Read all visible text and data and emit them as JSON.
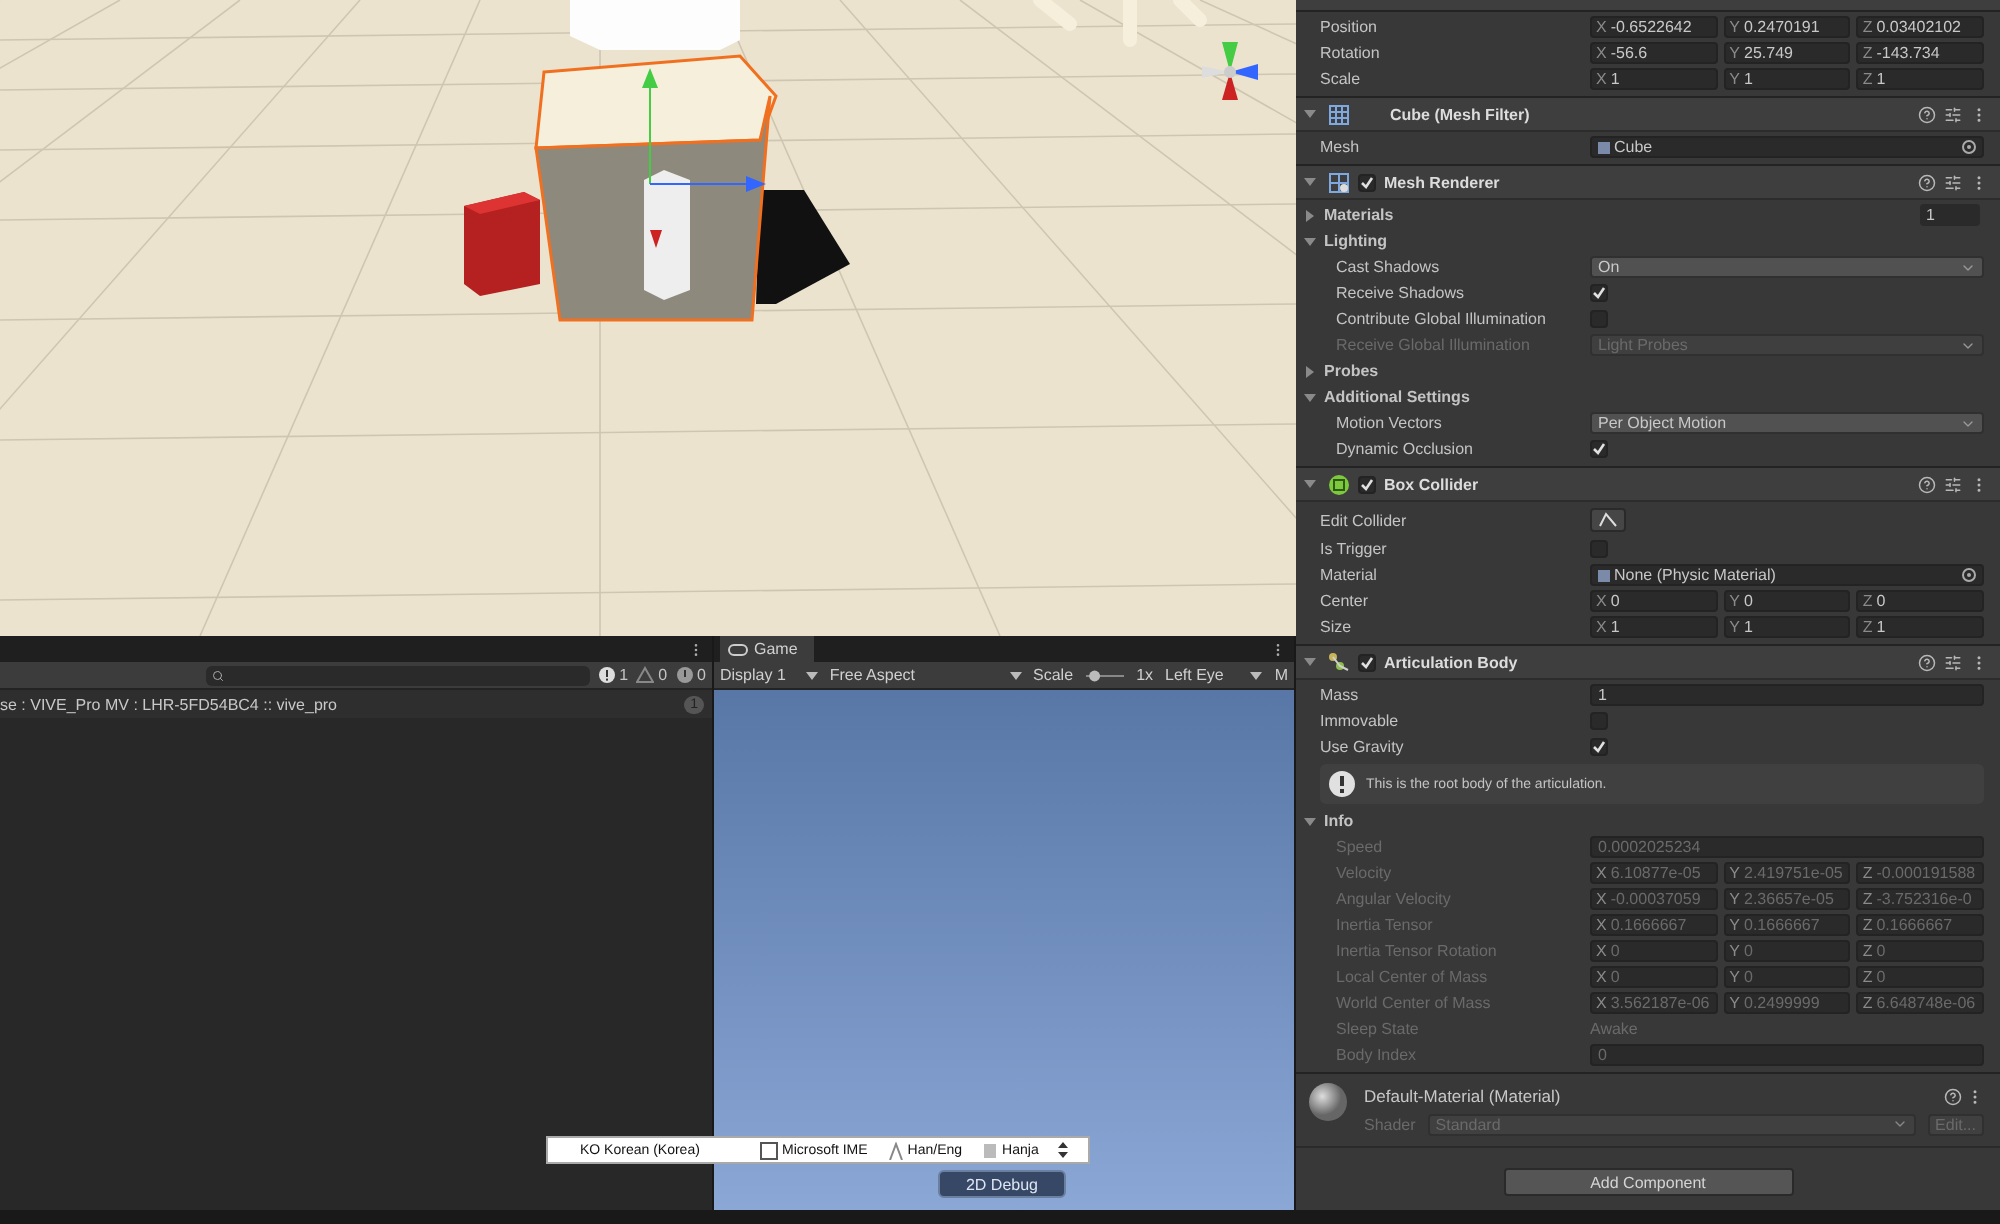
{
  "console": {
    "counters": [
      {
        "kind": "message",
        "count": "1"
      },
      {
        "kind": "warning",
        "count": "0"
      },
      {
        "kind": "info",
        "count": "0"
      }
    ],
    "logs": [
      {
        "text": "se : VIVE_Pro MV : LHR-5FD54BC4 :: vive_pro",
        "count": "1"
      }
    ]
  },
  "game": {
    "tab": "Game",
    "display": "Display 1",
    "aspect": "Free Aspect",
    "scale_label": "Scale",
    "scale_slider": {
      "level": 0.1
    },
    "scale": "1x",
    "eye": "Left Eye",
    "more": "M",
    "debug_button": "2D Debug"
  },
  "ime_bar": {
    "language": "KO Korean (Korea)",
    "ime": "Microsoft IME",
    "mode": "Han/Eng",
    "hanja": "Hanja"
  },
  "inspector": {
    "components": [
      {
        "kind": "transform",
        "rows": [
          {
            "kind": "vector3",
            "label": "Position",
            "fields": [
              {
                "axis": "X",
                "value": "-0.6522642"
              },
              {
                "axis": "Y",
                "value": "0.2470191"
              },
              {
                "axis": "Z",
                "value": "0.03402102"
              }
            ],
            "disabled": false
          },
          {
            "kind": "vector3",
            "label": "Rotation",
            "fields": [
              {
                "axis": "X",
                "value": "-56.6"
              },
              {
                "axis": "Y",
                "value": "25.749"
              },
              {
                "axis": "Z",
                "value": "-143.734"
              }
            ],
            "disabled": false
          },
          {
            "kind": "vector3",
            "label": "Scale",
            "fields": [
              {
                "axis": "X",
                "value": "1"
              },
              {
                "axis": "Y",
                "value": "1"
              },
              {
                "axis": "Z",
                "value": "1"
              }
            ],
            "disabled": false
          }
        ]
      },
      {
        "kind": "mesh_filter",
        "title": "Cube (Mesh Filter)",
        "rows": [
          {
            "kind": "object",
            "label": "Mesh",
            "value": "Cube",
            "disabled": false
          }
        ]
      },
      {
        "kind": "mesh_renderer",
        "title": "Mesh Renderer",
        "enabled": true,
        "rows": [
          {
            "kind": "foldout",
            "label": "Materials",
            "value": "1",
            "expanded": false,
            "children": []
          },
          {
            "kind": "foldout",
            "label": "Lighting",
            "expanded": true,
            "children": [
              {
                "kind": "dropdown",
                "label": "Cast Shadows",
                "value": "On",
                "disabled": false
              },
              {
                "kind": "checkbox",
                "label": "Receive Shadows",
                "checked": true,
                "disabled": false
              },
              {
                "kind": "checkbox",
                "label": "Contribute Global Illumination",
                "checked": false,
                "disabled": false
              },
              {
                "kind": "dropdown",
                "label": "Receive Global Illumination",
                "value": "Light Probes",
                "disabled": true
              }
            ]
          },
          {
            "kind": "foldout",
            "label": "Probes",
            "expanded": false,
            "children": []
          },
          {
            "kind": "foldout",
            "label": "Additional Settings",
            "expanded": true,
            "children": [
              {
                "kind": "dropdown",
                "label": "Motion Vectors",
                "value": "Per Object Motion",
                "disabled": false
              },
              {
                "kind": "checkbox",
                "label": "Dynamic Occlusion",
                "checked": true,
                "disabled": false
              }
            ]
          }
        ]
      },
      {
        "kind": "box_collider",
        "title": "Box Collider",
        "enabled": true,
        "rows": [
          {
            "kind": "icon_button",
            "label": "Edit Collider",
            "disabled": false
          },
          {
            "kind": "checkbox",
            "label": "Is Trigger",
            "checked": false,
            "disabled": false
          },
          {
            "kind": "object",
            "label": "Material",
            "value": "None (Physic Material)",
            "disabled": false
          },
          {
            "kind": "vector3",
            "label": "Center",
            "fields": [
              {
                "axis": "X",
                "value": "0"
              },
              {
                "axis": "Y",
                "value": "0"
              },
              {
                "axis": "Z",
                "value": "0"
              }
            ],
            "disabled": false
          },
          {
            "kind": "vector3",
            "label": "Size",
            "fields": [
              {
                "axis": "X",
                "value": "1"
              },
              {
                "axis": "Y",
                "value": "1"
              },
              {
                "axis": "Z",
                "value": "1"
              }
            ],
            "disabled": false
          }
        ]
      },
      {
        "kind": "articulation_body",
        "title": "Articulation Body",
        "enabled": true,
        "rows": [
          {
            "kind": "text",
            "label": "Mass",
            "value": "1",
            "disabled": false
          },
          {
            "kind": "checkbox",
            "label": "Immovable",
            "checked": false,
            "disabled": false
          },
          {
            "kind": "checkbox",
            "label": "Use Gravity",
            "checked": true,
            "disabled": false
          },
          {
            "kind": "help",
            "text": "This is the root body of the articulation."
          },
          {
            "kind": "foldout",
            "label": "Info",
            "expanded": true,
            "children": [
              {
                "kind": "text",
                "label": "Speed",
                "value": "0.0002025234",
                "disabled": true
              },
              {
                "kind": "vector3",
                "label": "Velocity",
                "fields": [
                  {
                    "axis": "X",
                    "value": "6.10877e-05"
                  },
                  {
                    "axis": "Y",
                    "value": "2.419751e-05"
                  },
                  {
                    "axis": "Z",
                    "value": "-0.000191588"
                  }
                ],
                "disabled": true
              },
              {
                "kind": "vector3",
                "label": "Angular Velocity",
                "fields": [
                  {
                    "axis": "X",
                    "value": "-0.00037059"
                  },
                  {
                    "axis": "Y",
                    "value": "2.36657e-05"
                  },
                  {
                    "axis": "Z",
                    "value": "-3.752316e-0"
                  }
                ],
                "disabled": true
              },
              {
                "kind": "vector3",
                "label": "Inertia Tensor",
                "fields": [
                  {
                    "axis": "X",
                    "value": "0.1666667"
                  },
                  {
                    "axis": "Y",
                    "value": "0.1666667"
                  },
                  {
                    "axis": "Z",
                    "value": "0.1666667"
                  }
                ],
                "disabled": true
              },
              {
                "kind": "vector3",
                "label": "Inertia Tensor Rotation",
                "fields": [
                  {
                    "axis": "X",
                    "value": "0"
                  },
                  {
                    "axis": "Y",
                    "value": "0"
                  },
                  {
                    "axis": "Z",
                    "value": "0"
                  }
                ],
                "disabled": true
              },
              {
                "kind": "vector3",
                "label": "Local Center of Mass",
                "fields": [
                  {
                    "axis": "X",
                    "value": "0"
                  },
                  {
                    "axis": "Y",
                    "value": "0"
                  },
                  {
                    "axis": "Z",
                    "value": "0"
                  }
                ],
                "disabled": true
              },
              {
                "kind": "vector3",
                "label": "World Center of Mass",
                "fields": [
                  {
                    "axis": "X",
                    "value": "3.562187e-06"
                  },
                  {
                    "axis": "Y",
                    "value": "0.2499999"
                  },
                  {
                    "axis": "Z",
                    "value": "6.648748e-06"
                  }
                ],
                "disabled": true
              },
              {
                "kind": "label",
                "label": "Sleep State",
                "value": "Awake",
                "disabled": true
              },
              {
                "kind": "text",
                "label": "Body Index",
                "value": "0",
                "disabled": true
              }
            ]
          }
        ]
      }
    ],
    "material": {
      "name": "Default-Material (Material)",
      "shader_label": "Shader",
      "shader": "Standard",
      "edit": "Edit..."
    },
    "add_component": "Add Component"
  }
}
